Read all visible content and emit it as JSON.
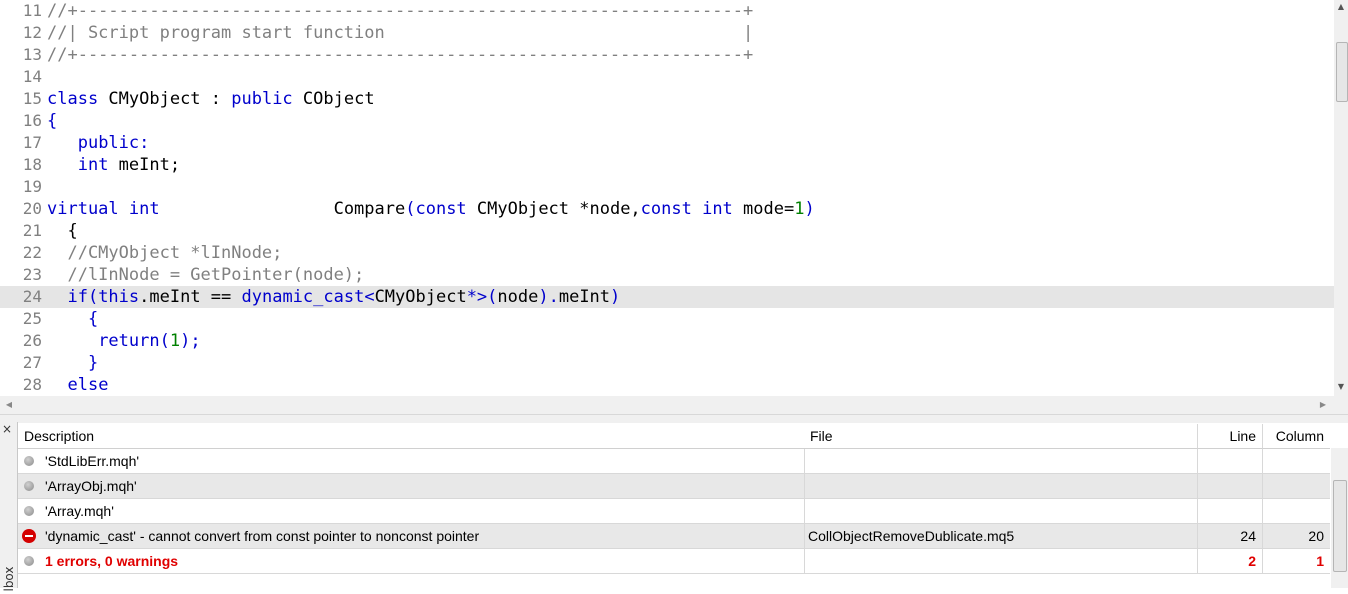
{
  "editor": {
    "lines": [
      {
        "no": "11",
        "parts": [
          {
            "t": "//+-----------------------------------------------------------------+",
            "c": "c"
          }
        ]
      },
      {
        "no": "12",
        "parts": [
          {
            "t": "//| Script program start function                                   |",
            "c": "c"
          }
        ]
      },
      {
        "no": "13",
        "parts": [
          {
            "t": "//+-----------------------------------------------------------------+",
            "c": "c"
          }
        ]
      },
      {
        "no": "14",
        "parts": []
      },
      {
        "no": "15",
        "parts": [
          {
            "t": "class",
            "c": "k"
          },
          {
            "t": " CMyObject : "
          },
          {
            "t": "public",
            "c": "k"
          },
          {
            "t": " CObject"
          }
        ]
      },
      {
        "no": "16",
        "parts": [
          {
            "t": "{",
            "c": "k"
          }
        ]
      },
      {
        "no": "17",
        "parts": [
          {
            "t": "   "
          },
          {
            "t": "public:",
            "c": "k"
          }
        ]
      },
      {
        "no": "18",
        "parts": [
          {
            "t": "   "
          },
          {
            "t": "int",
            "c": "k"
          },
          {
            "t": " meInt;"
          }
        ]
      },
      {
        "no": "19",
        "parts": []
      },
      {
        "no": "20",
        "parts": [
          {
            "t": "virtual int",
            "c": "k"
          },
          {
            "t": "                 Compare"
          },
          {
            "t": "(",
            "c": "k"
          },
          {
            "t": "const",
            "c": "k"
          },
          {
            "t": " CMyObject *node,"
          },
          {
            "t": "const int",
            "c": "k"
          },
          {
            "t": " mode="
          },
          {
            "t": "1",
            "c": "n"
          },
          {
            "t": ")",
            "c": "k"
          }
        ]
      },
      {
        "no": "21",
        "parts": [
          {
            "t": "  {"
          }
        ]
      },
      {
        "no": "22",
        "parts": [
          {
            "t": "  //CMyObject *lInNode;",
            "c": "c"
          }
        ]
      },
      {
        "no": "23",
        "parts": [
          {
            "t": "  //lInNode = GetPointer(node);",
            "c": "c"
          }
        ]
      },
      {
        "no": "24",
        "parts": [
          {
            "t": "  "
          },
          {
            "t": "if(this",
            "c": "k"
          },
          {
            "t": ".meInt == "
          },
          {
            "t": "dynamic_cast<",
            "c": "k"
          },
          {
            "t": "CMyObject"
          },
          {
            "t": "*>(",
            "c": "k"
          },
          {
            "t": "node"
          },
          {
            "t": ").",
            "c": "k"
          },
          {
            "t": "meInt"
          },
          {
            "t": ")",
            "c": "k"
          }
        ],
        "highlight": true
      },
      {
        "no": "25",
        "parts": [
          {
            "t": "    {",
            "c": "k"
          }
        ]
      },
      {
        "no": "26",
        "parts": [
          {
            "t": "     "
          },
          {
            "t": "return(",
            "c": "k"
          },
          {
            "t": "1",
            "c": "n"
          },
          {
            "t": ");",
            "c": "k"
          }
        ]
      },
      {
        "no": "27",
        "parts": [
          {
            "t": "    }",
            "c": "k"
          }
        ]
      },
      {
        "no": "28",
        "parts": [
          {
            "t": "  "
          },
          {
            "t": "else",
            "c": "k"
          }
        ]
      }
    ]
  },
  "toolbox": {
    "close_glyph": "×",
    "tab_label": "lbox",
    "columns": {
      "description": "Description",
      "file": "File",
      "line": "Line",
      "column": "Column"
    },
    "rows": [
      {
        "icon": "info-icon",
        "description": "'StdLibErr.mqh'",
        "file": "",
        "line": "",
        "column": "",
        "style": "normal"
      },
      {
        "icon": "info-icon",
        "description": "'ArrayObj.mqh'",
        "file": "",
        "line": "",
        "column": "",
        "style": "normal"
      },
      {
        "icon": "info-icon",
        "description": "'Array.mqh'",
        "file": "",
        "line": "",
        "column": "",
        "style": "normal"
      },
      {
        "icon": "error-icon",
        "description": "'dynamic_cast' - cannot convert from const pointer to nonconst pointer",
        "file": "CollObjectRemoveDublicate.mq5",
        "line": "24",
        "column": "20",
        "style": "normal"
      },
      {
        "icon": "info-icon",
        "description": "1 errors, 0 warnings",
        "file": "",
        "line": "2",
        "column": "1",
        "style": "summary"
      }
    ]
  },
  "colors": {
    "keyword": "#0000cc",
    "comment": "#808080",
    "number": "#008000",
    "error": "#e00000",
    "highlight": "#e5e5e5"
  }
}
